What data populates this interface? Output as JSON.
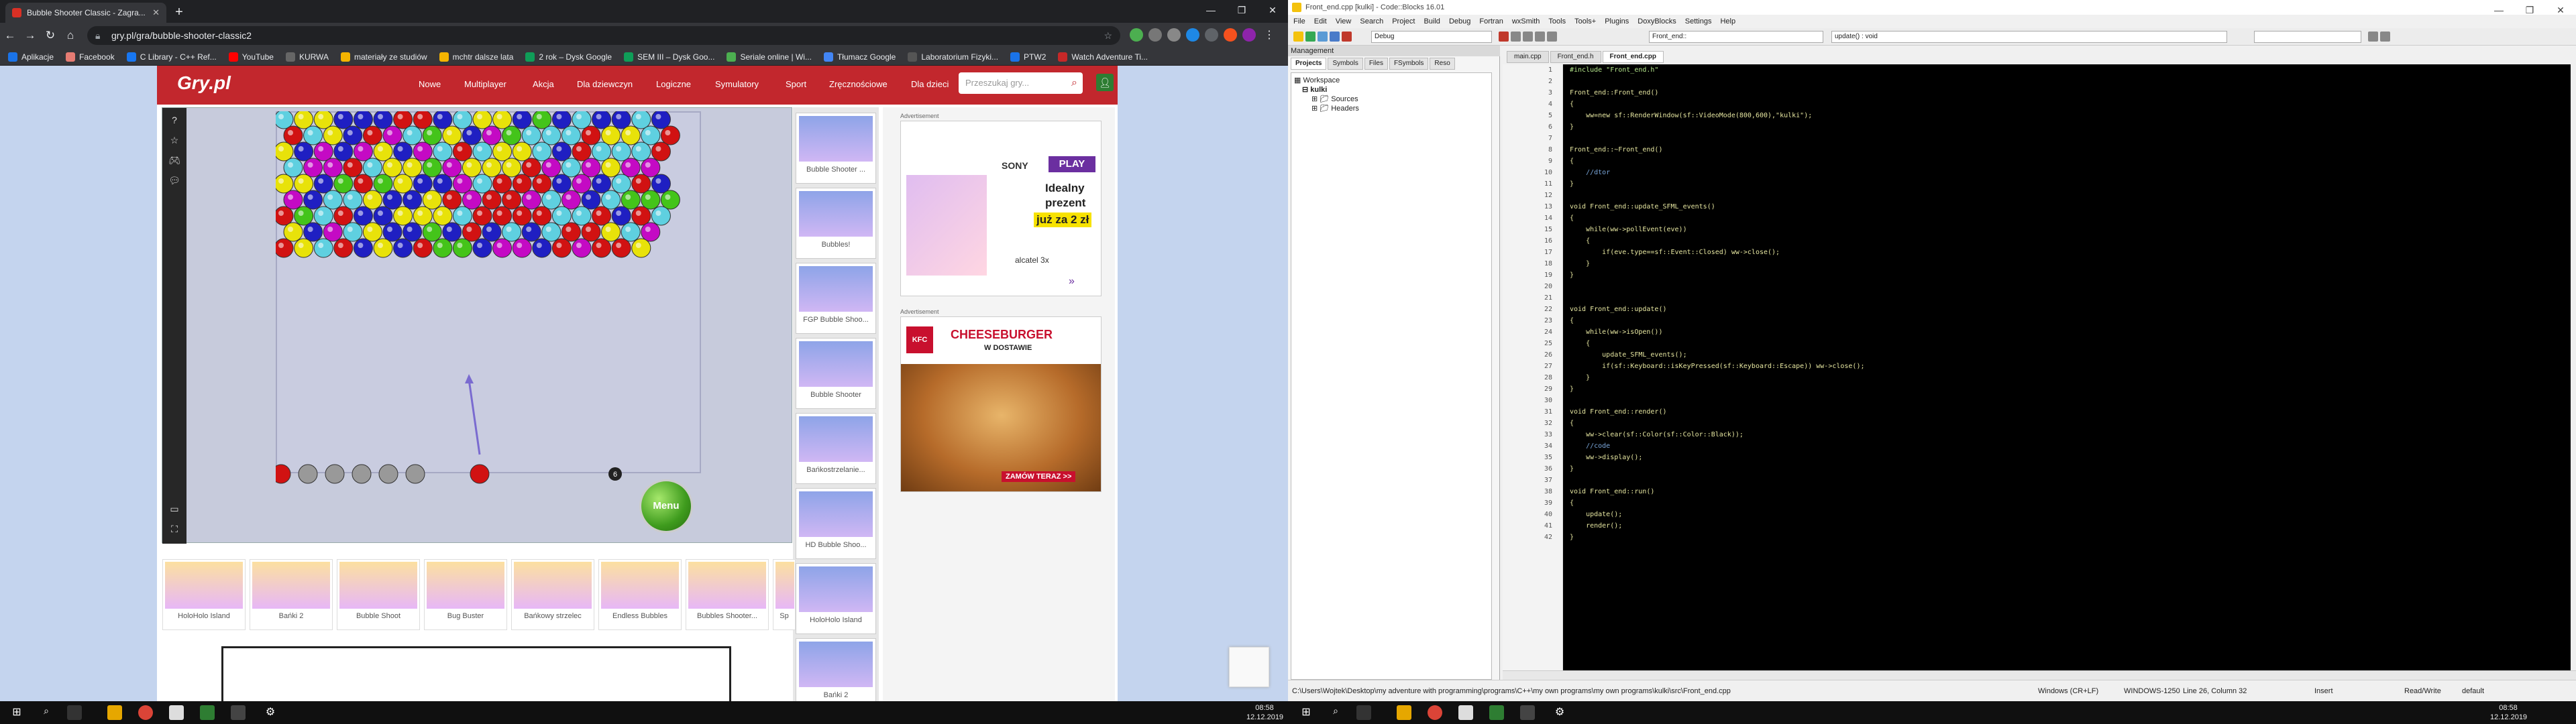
{
  "chrome": {
    "tab_title": "Bubble Shooter Classic - Zagra...",
    "url": "gry.pl/gra/bubble-shooter-classic2",
    "bookmarks": [
      "Aplikacje",
      "Facebook",
      "C Library - C++ Ref...",
      "YouTube",
      "KURWA",
      "materiały ze studiów",
      "mchtr dalsze lata",
      "2 rok – Dysk Google",
      "SEM III – Dysk Goo...",
      "Seriale online | Wi...",
      "Tłumacz Google",
      "Laboratorium Fizyki...",
      "PTW2",
      "Watch Adventure Ti..."
    ]
  },
  "site": {
    "logo": "Gry.pl",
    "nav": [
      "Nowe",
      "Multiplayer",
      "Akcja",
      "Dla dziewczyn",
      "Logiczne",
      "Symulatory",
      "Sport",
      "Zręcznościowe",
      "Dla dzieci"
    ],
    "search_placeholder": "Przeszukaj gry...",
    "menu_button": "Menu",
    "side_thumbs": [
      "Bubble Shooter ...",
      "Bubbles!",
      "FGP Bubble Shoo...",
      "Bubble Shooter",
      "Bańkostrzelanie...",
      "HD Bubble Shoo...",
      "HoloHolo Island",
      "Bańki 2"
    ],
    "bottom_thumbs": [
      "HoloHolo Island",
      "Bańki 2",
      "Bubble Shoot",
      "Bug Buster",
      "Bańkowy strzelec",
      "Endless Bubbles",
      "Bubbles Shooter...",
      "Sp"
    ],
    "ad_label": "Advertisement",
    "ad1_text": [
      "SONY",
      "PLAY",
      "Idealny",
      "prezent",
      "już za 2 zł",
      "alcatel 3x"
    ],
    "ad2_text": [
      "CHEESEBURGER",
      "W DOSTAWIE",
      "ZAMÓW TERAZ >>",
      "KFC"
    ]
  },
  "game": {
    "colors": {
      "r": "#d11212",
      "y": "#e8e20a",
      "b": "#1f1fc2",
      "c": "#5fd0e0",
      "m": "#c40ac4",
      "g": "#44c41a",
      "s": "#999999"
    },
    "rows": [
      "cyybbbrrbcyybgbcbbcb",
      "rcybrmcgybmgcccryycr",
      "ybmbmybmcrcyycbrcccr",
      "cmmrcyygmyyyrmcmymm",
      "yybgrgybbmcrrrbmbcrb",
      "mbccybbyrmrrmcmbcggg",
      "rgcrbbyyycrrrrccrbrc",
      "ybmcybbgbrbcbcrrycm",
      "rycrbybrggbmmbrmrry"
    ],
    "queue": [
      "r",
      "s",
      "s",
      "s",
      "s",
      "s"
    ],
    "shooter_ball": "r",
    "counter": "6"
  },
  "codeblocks": {
    "title": "Front_end.cpp [kulki] - Code::Blocks 16.01",
    "menu": [
      "File",
      "Edit",
      "View",
      "Search",
      "Project",
      "Build",
      "Debug",
      "Fortran",
      "wxSmith",
      "Tools",
      "Tools+",
      "Plugins",
      "DoxyBlocks",
      "Settings",
      "Help"
    ],
    "build_target": "Debug",
    "scope_combo": "Front_end::",
    "function_combo": "update() : void",
    "management_label": "Management",
    "mgmt_tabs": [
      "Projects",
      "Symbols",
      "Files",
      "FSymbols",
      "Reso"
    ],
    "tree": [
      "Workspace",
      "kulki",
      "Sources",
      "Headers"
    ],
    "editor_tabs": [
      "main.cpp",
      "Front_end.h",
      "Front_end.cpp"
    ],
    "code_lines": [
      "#include \"Front_end.h\"",
      "",
      "Front_end::Front_end()",
      "{",
      "    ww=new sf::RenderWindow(sf::VideoMode(800,600),\"kulki\");",
      "}",
      "",
      "Front_end::~Front_end()",
      "{",
      "    //dtor",
      "}",
      "",
      "void Front_end::update_SFML_events()",
      "{",
      "    while(ww->pollEvent(eve))",
      "    {",
      "        if(eve.type==sf::Event::Closed) ww->close();",
      "    }",
      "}",
      "",
      "",
      "void Front_end::update()",
      "{",
      "    while(ww->isOpen())",
      "    {",
      "        update_SFML_events();",
      "        if(sf::Keyboard::isKeyPressed(sf::Keyboard::Escape)) ww->close();",
      "    }",
      "}",
      "",
      "void Front_end::render()",
      "{",
      "    ww->clear(sf::Color(sf::Color::Black));",
      "    //code",
      "    ww->display();",
      "}",
      "",
      "void Front_end::run()",
      "{",
      "    update();",
      "    render();",
      "}"
    ],
    "status": {
      "path": "C:\\Users\\Wojtek\\Desktop\\my adventure with programming\\programs\\C++\\my own programs\\my own programs\\kulki\\src\\Front_end.cpp",
      "eol": "Windows (CR+LF)",
      "encoding": "WINDOWS-1250",
      "position": "Line 26, Column 32",
      "mode": "Insert",
      "rw": "Read/Write",
      "profile": "default"
    }
  },
  "taskbar": {
    "left_time": "08:58",
    "left_date": "12.12.2019",
    "right_time": "08:58",
    "right_date": "12.12.2019"
  }
}
